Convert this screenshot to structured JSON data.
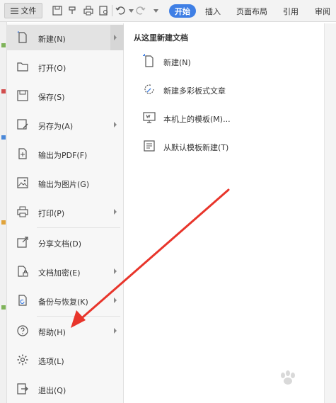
{
  "toolbar": {
    "file_label": "文件",
    "tabs": [
      "开始",
      "插入",
      "页面布局",
      "引用",
      "审阅"
    ]
  },
  "menu": {
    "items": [
      {
        "label": "新建(N)",
        "icon": "new-doc-icon",
        "has_submenu": true,
        "active": true
      },
      {
        "label": "打开(O)",
        "icon": "folder-icon",
        "has_submenu": false
      },
      {
        "label": "保存(S)",
        "icon": "save-icon",
        "has_submenu": false
      },
      {
        "label": "另存为(A)",
        "icon": "save-as-icon",
        "has_submenu": true
      },
      {
        "label": "输出为PDF(F)",
        "icon": "pdf-icon",
        "has_submenu": false
      },
      {
        "label": "输出为图片(G)",
        "icon": "image-icon",
        "has_submenu": false
      },
      {
        "label": "打印(P)",
        "icon": "print-icon",
        "has_submenu": true
      },
      {
        "label": "分享文档(D)",
        "icon": "share-icon",
        "has_submenu": false
      },
      {
        "label": "文档加密(E)",
        "icon": "encrypt-icon",
        "has_submenu": true
      },
      {
        "label": "备份与恢复(K)",
        "icon": "backup-icon",
        "has_submenu": true
      },
      {
        "label": "帮助(H)",
        "icon": "help-icon",
        "has_submenu": true
      },
      {
        "label": "选项(L)",
        "icon": "gear-icon",
        "has_submenu": false
      },
      {
        "label": "退出(Q)",
        "icon": "exit-icon",
        "has_submenu": false
      }
    ]
  },
  "submenu": {
    "title": "从这里新建文档",
    "items": [
      {
        "label": "新建(N)",
        "icon": "blank-doc-icon"
      },
      {
        "label": "新建多彩板式文章",
        "icon": "colorful-article-icon"
      },
      {
        "label": "本机上的模板(M)...",
        "icon": "local-template-icon"
      },
      {
        "label": "从默认模板新建(T)",
        "icon": "default-template-icon"
      }
    ]
  },
  "colors": {
    "accent": "#3f7fe5",
    "annotation_arrow": "#e8352b"
  }
}
